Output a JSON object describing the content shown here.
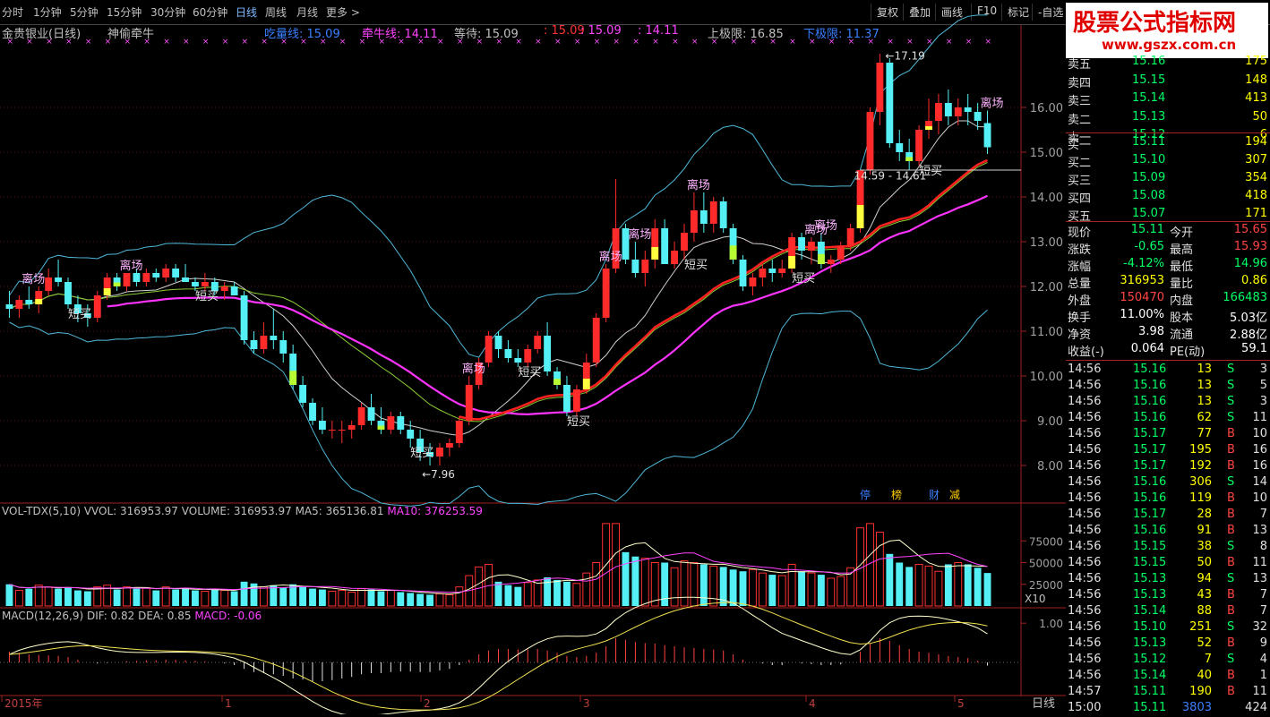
{
  "toolbar": {
    "periods": [
      "分时",
      "1分钟",
      "5分钟",
      "15分钟",
      "30分钟",
      "60分钟",
      "日线",
      "周线",
      "月线",
      "更多 >"
    ],
    "active_period": "日线",
    "buttons": [
      "复权",
      "叠加",
      "画线",
      "F10",
      "标记",
      "-自选"
    ]
  },
  "brand": {
    "title": "股票公式指标网",
    "url": "www.gszx.com.cn"
  },
  "chart_header": {
    "name": "金贵银业(日线)",
    "indicator": "神偷牵牛",
    "items": [
      {
        "label": "吃量线:",
        "value": "15.09",
        "color": "#3a7fff"
      },
      {
        "label": "牵牛线:",
        "value": "14.11",
        "color": "#ff44ff"
      },
      {
        "label": "等待:",
        "value": "15.09",
        "color": "#c0c0c0"
      },
      {
        "label": ":",
        "value": "15.09",
        "color": "#ff3333"
      },
      {
        "label": ":",
        "value": "15.09",
        "color": "#ff44ff"
      },
      {
        "label": ":",
        "value": "14.11",
        "color": "#ff44ff"
      },
      {
        "label": "上极限:",
        "value": "16.85",
        "color": "#c0c0c0"
      },
      {
        "label": "下极限:",
        "value": "11.37",
        "color": "#3a7fff"
      }
    ]
  },
  "main_axis": {
    "ticks": [
      "16.00",
      "15.00",
      "14.00",
      "13.00",
      "12.00",
      "11.00",
      "10.00",
      "9.00",
      "8.00"
    ]
  },
  "annotations": {
    "high": "17.19",
    "low": "7.96",
    "range": "14.59 - 14.61",
    "leave": "离场",
    "short_buy": "短买"
  },
  "bottom_tags": [
    "停",
    "榜",
    "财",
    "减"
  ],
  "vol_header": {
    "name": "VOL-TDX(5,10)",
    "vvol": "VVOL: 316953.97",
    "volume": "VOLUME: 316953.97",
    "ma5": "MA5: 365136.81",
    "ma10": "MA10: 376253.59"
  },
  "vol_axis": {
    "ticks": [
      "75000",
      "50000",
      "25000"
    ],
    "unit": "X10"
  },
  "macd_header": {
    "name": "MACD(12,26,9)",
    "dif": "DIF: 0.82",
    "dea": "DEA: 0.85",
    "macd": "MACD: -0.06"
  },
  "macd_axis": {
    "ticks": [
      "1.00"
    ]
  },
  "time_axis": {
    "labels": [
      "2015年",
      "1",
      "2",
      "3",
      "4",
      "5"
    ],
    "period": "日线"
  },
  "quote": {
    "sells": [
      {
        "label": "卖五",
        "price": "15.16",
        "vol": "175"
      },
      {
        "label": "卖四",
        "price": "15.15",
        "vol": "148"
      },
      {
        "label": "卖三",
        "price": "15.14",
        "vol": "413"
      },
      {
        "label": "卖二",
        "price": "15.13",
        "vol": "50"
      },
      {
        "label": "卖一",
        "price": "15.12",
        "vol": "6"
      }
    ],
    "buys": [
      {
        "label": "买一",
        "price": "15.11",
        "vol": "194"
      },
      {
        "label": "买二",
        "price": "15.10",
        "vol": "307"
      },
      {
        "label": "买三",
        "price": "15.09",
        "vol": "354"
      },
      {
        "label": "买四",
        "price": "15.08",
        "vol": "418"
      },
      {
        "label": "买五",
        "price": "15.07",
        "vol": "171"
      }
    ],
    "stats": [
      [
        {
          "k": "现价",
          "v": "15.11",
          "c": "#00ff66"
        },
        {
          "k": "今开",
          "v": "15.65",
          "c": "#ff4444"
        }
      ],
      [
        {
          "k": "涨跌",
          "v": "-0.65",
          "c": "#00ff66"
        },
        {
          "k": "最高",
          "v": "15.93",
          "c": "#ff4444"
        }
      ],
      [
        {
          "k": "涨幅",
          "v": "-4.12%",
          "c": "#00ff66"
        },
        {
          "k": "最低",
          "v": "14.96",
          "c": "#00ff66"
        }
      ],
      [
        {
          "k": "总量",
          "v": "316953",
          "c": "#ffff00"
        },
        {
          "k": "量比",
          "v": "0.86",
          "c": "#ffff00"
        }
      ],
      [
        {
          "k": "外盘",
          "v": "150470",
          "c": "#ff4444"
        },
        {
          "k": "内盘",
          "v": "166483",
          "c": "#00ff66"
        }
      ],
      [
        {
          "k": "换手",
          "v": "11.00%",
          "c": "#ffffff"
        },
        {
          "k": "股本",
          "v": "5.03亿",
          "c": "#ffffff"
        }
      ],
      [
        {
          "k": "净资",
          "v": "3.98",
          "c": "#ffffff"
        },
        {
          "k": "流通",
          "v": "2.88亿",
          "c": "#ffffff"
        }
      ],
      [
        {
          "k": "收益(-)",
          "v": "0.064",
          "c": "#ffffff"
        },
        {
          "k": "PE(动)",
          "v": "59.1",
          "c": "#ffffff"
        }
      ]
    ],
    "ticks": [
      {
        "t": "14:56",
        "p": "15.16",
        "v": "13",
        "s": "S",
        "n": "3"
      },
      {
        "t": "14:56",
        "p": "15.16",
        "v": "13",
        "s": "S",
        "n": "5"
      },
      {
        "t": "14:56",
        "p": "15.16",
        "v": "13",
        "s": "S",
        "n": "3"
      },
      {
        "t": "14:56",
        "p": "15.16",
        "v": "62",
        "s": "S",
        "n": "11"
      },
      {
        "t": "14:56",
        "p": "15.17",
        "v": "77",
        "s": "B",
        "n": "10"
      },
      {
        "t": "14:56",
        "p": "15.17",
        "v": "195",
        "s": "B",
        "n": "16"
      },
      {
        "t": "14:56",
        "p": "15.17",
        "v": "192",
        "s": "B",
        "n": "16"
      },
      {
        "t": "14:56",
        "p": "15.16",
        "v": "306",
        "s": "S",
        "n": "14"
      },
      {
        "t": "14:56",
        "p": "15.16",
        "v": "119",
        "s": "B",
        "n": "10"
      },
      {
        "t": "14:56",
        "p": "15.17",
        "v": "28",
        "s": "B",
        "n": "7"
      },
      {
        "t": "14:56",
        "p": "15.16",
        "v": "91",
        "s": "B",
        "n": "13"
      },
      {
        "t": "14:56",
        "p": "15.15",
        "v": "38",
        "s": "S",
        "n": "8"
      },
      {
        "t": "14:56",
        "p": "15.15",
        "v": "50",
        "s": "B",
        "n": "11"
      },
      {
        "t": "14:56",
        "p": "15.13",
        "v": "94",
        "s": "S",
        "n": "13"
      },
      {
        "t": "14:56",
        "p": "15.13",
        "v": "43",
        "s": "B",
        "n": "7"
      },
      {
        "t": "14:56",
        "p": "15.14",
        "v": "88",
        "s": "B",
        "n": "7"
      },
      {
        "t": "14:56",
        "p": "15.10",
        "v": "251",
        "s": "S",
        "n": "32"
      },
      {
        "t": "14:56",
        "p": "15.13",
        "v": "52",
        "s": "B",
        "n": "9"
      },
      {
        "t": "14:56",
        "p": "15.12",
        "v": "7",
        "s": "S",
        "n": "4"
      },
      {
        "t": "14:56",
        "p": "15.14",
        "v": "40",
        "s": "B",
        "n": "1"
      },
      {
        "t": "14:57",
        "p": "15.11",
        "v": "190",
        "s": "B",
        "n": "11"
      },
      {
        "t": "15:00",
        "p": "15.11",
        "v": "3803",
        "s": "",
        "n": "424"
      }
    ]
  },
  "chart_data": {
    "type": "candlestick",
    "price_range": [
      7.5,
      17.5
    ],
    "candles": [
      [
        11.6,
        11.9,
        11.3,
        11.5
      ],
      [
        11.5,
        11.8,
        11.3,
        11.7
      ],
      [
        11.7,
        12.0,
        11.5,
        11.6
      ],
      [
        11.6,
        12.0,
        11.4,
        11.9
      ],
      [
        11.9,
        12.4,
        11.8,
        12.2
      ],
      [
        12.2,
        12.6,
        12.0,
        12.1
      ],
      [
        12.1,
        12.2,
        11.5,
        11.6
      ],
      [
        11.6,
        11.8,
        11.2,
        11.4
      ],
      [
        11.4,
        11.6,
        11.1,
        11.3
      ],
      [
        11.3,
        11.9,
        11.2,
        11.8
      ],
      [
        11.8,
        12.3,
        11.7,
        12.2
      ],
      [
        12.2,
        12.3,
        11.9,
        12.0
      ],
      [
        12.0,
        12.3,
        11.9,
        12.3
      ],
      [
        12.3,
        12.4,
        12.0,
        12.1
      ],
      [
        12.1,
        12.4,
        12.0,
        12.3
      ],
      [
        12.3,
        12.4,
        12.1,
        12.2
      ],
      [
        12.2,
        12.5,
        12.1,
        12.4
      ],
      [
        12.4,
        12.5,
        12.1,
        12.2
      ],
      [
        12.2,
        12.5,
        12.1,
        12.1
      ],
      [
        12.1,
        12.2,
        11.9,
        12.0
      ],
      [
        12.0,
        12.3,
        11.9,
        12.1
      ],
      [
        12.1,
        12.2,
        11.8,
        11.9
      ],
      [
        11.9,
        12.1,
        11.7,
        12.0
      ],
      [
        12.0,
        12.1,
        11.8,
        11.8
      ],
      [
        11.8,
        11.9,
        10.7,
        10.8
      ],
      [
        10.8,
        11.0,
        10.5,
        10.6
      ],
      [
        10.6,
        11.2,
        10.5,
        10.9
      ],
      [
        10.9,
        11.5,
        10.6,
        10.8
      ],
      [
        10.8,
        11.0,
        10.3,
        10.5
      ],
      [
        10.5,
        10.7,
        9.7,
        9.8
      ],
      [
        9.8,
        10.0,
        9.3,
        9.4
      ],
      [
        9.4,
        9.5,
        8.9,
        9.0
      ],
      [
        9.0,
        9.3,
        8.7,
        8.8
      ],
      [
        8.8,
        9.0,
        8.6,
        8.8
      ],
      [
        8.8,
        9.0,
        8.5,
        8.8
      ],
      [
        8.8,
        9.0,
        8.6,
        8.9
      ],
      [
        8.9,
        9.4,
        8.8,
        9.3
      ],
      [
        9.3,
        9.6,
        8.9,
        9.0
      ],
      [
        9.0,
        9.3,
        8.7,
        8.8
      ],
      [
        8.8,
        9.2,
        8.7,
        9.1
      ],
      [
        9.1,
        9.2,
        8.7,
        8.8
      ],
      [
        8.8,
        9.0,
        8.4,
        8.6
      ],
      [
        8.6,
        8.8,
        8.1,
        8.3
      ],
      [
        8.3,
        8.5,
        8.0,
        8.2
      ],
      [
        8.2,
        8.5,
        8.0,
        8.4
      ],
      [
        8.4,
        8.6,
        8.2,
        8.5
      ],
      [
        8.5,
        9.1,
        8.4,
        9.0
      ],
      [
        9.0,
        10.0,
        8.9,
        9.8
      ],
      [
        9.8,
        10.4,
        9.7,
        10.3
      ],
      [
        10.3,
        11.0,
        10.2,
        10.9
      ],
      [
        10.9,
        11.0,
        10.4,
        10.6
      ],
      [
        10.6,
        10.8,
        10.3,
        10.4
      ],
      [
        10.4,
        10.6,
        10.2,
        10.3
      ],
      [
        10.3,
        10.7,
        10.2,
        10.6
      ],
      [
        10.6,
        11.0,
        10.5,
        10.9
      ],
      [
        10.9,
        11.2,
        10.0,
        10.1
      ],
      [
        10.1,
        10.2,
        9.7,
        9.8
      ],
      [
        9.8,
        10.0,
        9.1,
        9.2
      ],
      [
        9.2,
        9.8,
        9.1,
        9.7
      ],
      [
        9.7,
        10.5,
        9.6,
        10.3
      ],
      [
        10.3,
        11.4,
        10.2,
        11.3
      ],
      [
        11.3,
        12.5,
        11.2,
        12.4
      ],
      [
        12.4,
        14.4,
        12.3,
        13.3
      ],
      [
        13.3,
        13.4,
        12.5,
        12.6
      ],
      [
        12.6,
        13.0,
        12.2,
        12.3
      ],
      [
        12.3,
        12.8,
        12.0,
        12.6
      ],
      [
        12.6,
        13.5,
        12.4,
        13.3
      ],
      [
        13.3,
        13.5,
        12.5,
        12.5
      ],
      [
        12.5,
        13.0,
        12.4,
        12.8
      ],
      [
        12.8,
        13.4,
        12.6,
        13.2
      ],
      [
        13.2,
        14.1,
        13.0,
        13.7
      ],
      [
        13.7,
        14.1,
        13.2,
        13.4
      ],
      [
        13.4,
        14.0,
        13.2,
        13.9
      ],
      [
        13.9,
        14.0,
        13.2,
        13.3
      ],
      [
        13.3,
        13.4,
        12.5,
        12.6
      ],
      [
        12.6,
        12.7,
        11.9,
        12.0
      ],
      [
        12.0,
        12.3,
        11.8,
        12.2
      ],
      [
        12.2,
        12.5,
        12.0,
        12.4
      ],
      [
        12.4,
        12.6,
        12.1,
        12.3
      ],
      [
        12.3,
        12.6,
        12.2,
        12.4
      ],
      [
        12.4,
        13.2,
        12.3,
        13.1
      ],
      [
        13.1,
        13.2,
        12.6,
        12.8
      ],
      [
        12.8,
        13.1,
        12.5,
        13.0
      ],
      [
        13.0,
        13.2,
        12.4,
        12.5
      ],
      [
        12.5,
        12.7,
        12.3,
        12.6
      ],
      [
        12.6,
        13.0,
        12.5,
        12.9
      ],
      [
        12.9,
        13.4,
        12.8,
        13.3
      ],
      [
        13.3,
        14.6,
        13.2,
        14.6
      ],
      [
        14.6,
        16.0,
        14.5,
        15.9
      ],
      [
        15.9,
        17.2,
        15.6,
        17.0
      ],
      [
        17.0,
        17.1,
        15.1,
        15.2
      ],
      [
        15.2,
        15.5,
        14.8,
        15.0
      ],
      [
        15.0,
        15.3,
        14.6,
        14.8
      ],
      [
        14.8,
        15.6,
        14.7,
        15.5
      ],
      [
        15.5,
        16.2,
        15.3,
        15.7
      ],
      [
        15.7,
        16.3,
        15.4,
        16.1
      ],
      [
        16.1,
        16.4,
        15.6,
        15.8
      ],
      [
        15.8,
        16.2,
        15.6,
        16.0
      ],
      [
        16.0,
        16.3,
        15.6,
        15.9
      ],
      [
        15.9,
        16.1,
        15.5,
        15.7
      ],
      [
        15.65,
        15.93,
        14.96,
        15.11
      ]
    ],
    "volume": [
      25,
      18,
      20,
      24,
      22,
      20,
      21,
      18,
      17,
      22,
      24,
      19,
      22,
      20,
      21,
      18,
      22,
      19,
      20,
      18,
      17,
      20,
      18,
      17,
      28,
      26,
      22,
      24,
      21,
      25,
      22,
      20,
      19,
      17,
      18,
      16,
      20,
      19,
      17,
      18,
      16,
      15,
      14,
      13,
      14,
      13,
      22,
      35,
      45,
      48,
      28,
      24,
      22,
      27,
      30,
      33,
      30,
      28,
      26,
      38,
      50,
      95,
      95,
      62,
      57,
      55,
      50,
      50,
      44,
      52,
      50,
      48,
      46,
      45,
      42,
      40,
      42,
      38,
      36,
      35,
      48,
      40,
      38,
      36,
      32,
      34,
      44,
      90,
      95,
      85,
      60,
      50,
      45,
      48,
      46,
      40,
      48,
      50,
      48,
      44,
      38
    ],
    "macd": [
      0.2,
      0.18,
      0.15,
      0.14,
      0.13,
      0.12,
      0.1,
      0.05,
      0.0,
      -0.02,
      -0.01,
      0.0,
      0.02,
      0.03,
      0.04,
      0.04,
      0.05,
      0.05,
      0.04,
      0.03,
      0.02,
      0.0,
      -0.02,
      -0.05,
      -0.12,
      -0.18,
      -0.2,
      -0.22,
      -0.25,
      -0.3,
      -0.32,
      -0.35,
      -0.35,
      -0.33,
      -0.3,
      -0.27,
      -0.22,
      -0.2,
      -0.2,
      -0.18,
      -0.17,
      -0.17,
      -0.18,
      -0.18,
      -0.15,
      -0.12,
      -0.05,
      0.05,
      0.15,
      0.22,
      0.25,
      0.25,
      0.24,
      0.24,
      0.25,
      0.22,
      0.18,
      0.12,
      0.1,
      0.12,
      0.18,
      0.3,
      0.45,
      0.42,
      0.38,
      0.36,
      0.35,
      0.32,
      0.3,
      0.28,
      0.27,
      0.25,
      0.24,
      0.22,
      0.15,
      0.05,
      0.0,
      -0.02,
      -0.05,
      -0.05,
      0.0,
      -0.02,
      -0.03,
      -0.05,
      -0.05,
      -0.04,
      0.0,
      0.2,
      0.35,
      0.45,
      0.4,
      0.32,
      0.25,
      0.2,
      0.18,
      0.15,
      0.12,
      0.1,
      0.08,
      0.03,
      -0.06
    ]
  }
}
